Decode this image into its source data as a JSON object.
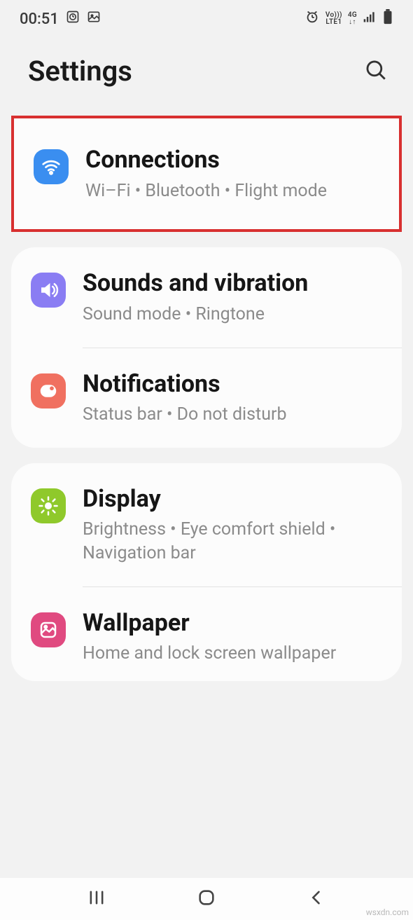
{
  "status": {
    "time": "00:51",
    "volte_top": "Vo)))",
    "volte_bot": "LTE1",
    "net": "4G"
  },
  "header": {
    "title": "Settings"
  },
  "cards": [
    {
      "id": "connections",
      "title": "Connections",
      "sub": "Wi–Fi  •  Bluetooth  •  Flight mode",
      "color": "#3a8ef0",
      "highlight": true
    },
    {
      "id": "sounds",
      "title": "Sounds and vibration",
      "sub": "Sound mode  •  Ringtone",
      "color": "#8a7df3"
    },
    {
      "id": "notifications",
      "title": "Notifications",
      "sub": "Status bar  •  Do not disturb",
      "color": "#f07060"
    },
    {
      "id": "display",
      "title": "Display",
      "sub": "Brightness  •  Eye comfort shield  •  Navigation bar",
      "color": "#8fc92b"
    },
    {
      "id": "wallpaper",
      "title": "Wallpaper",
      "sub": "Home and lock screen wallpaper",
      "color": "#e04a80"
    }
  ],
  "watermark": "wsxdn.com"
}
